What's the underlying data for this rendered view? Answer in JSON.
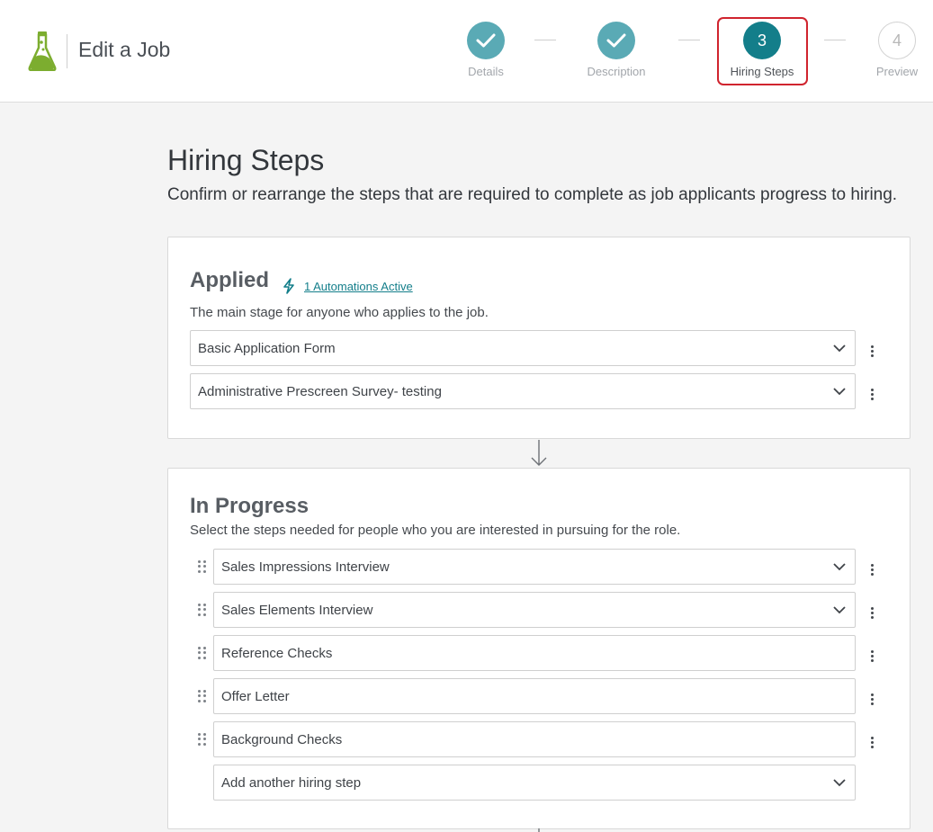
{
  "header": {
    "title": "Edit a Job",
    "steps": [
      {
        "number": "1",
        "label": "Details",
        "state": "done"
      },
      {
        "number": "2",
        "label": "Description",
        "state": "done"
      },
      {
        "number": "3",
        "label": "Hiring Steps",
        "state": "active"
      },
      {
        "number": "4",
        "label": "Preview",
        "state": "pending"
      }
    ]
  },
  "page": {
    "title": "Hiring Steps",
    "subtitle": "Confirm or rearrange the steps that are required to complete as job applicants progress to hiring."
  },
  "applied": {
    "title": "Applied",
    "automation_link": "1 Automations Active",
    "description": "The main stage for anyone who applies to the job.",
    "steps": [
      "Basic Application Form",
      "Administrative Prescreen Survey- testing"
    ]
  },
  "in_progress": {
    "title": "In Progress",
    "description": "Select the steps needed for people who you are interested in pursuing for the role.",
    "steps": [
      "Sales Impressions Interview",
      "Sales Elements Interview",
      "Reference Checks",
      "Offer Letter",
      "Background Checks"
    ],
    "add_step_placeholder": "Add another hiring step"
  },
  "colors": {
    "accent": "#137e8a",
    "done_step": "#5aaab5",
    "highlight": "#d0242e",
    "logo": "#7cad2f"
  },
  "icons": {
    "logo": "flask-logo-icon",
    "done": "checkmark-icon",
    "automation": "lightning-bolt-icon",
    "dropdown": "chevron-down-icon",
    "menu": "vertical-ellipsis-icon",
    "drag": "drag-handle-icon",
    "flow": "arrow-down-icon"
  }
}
